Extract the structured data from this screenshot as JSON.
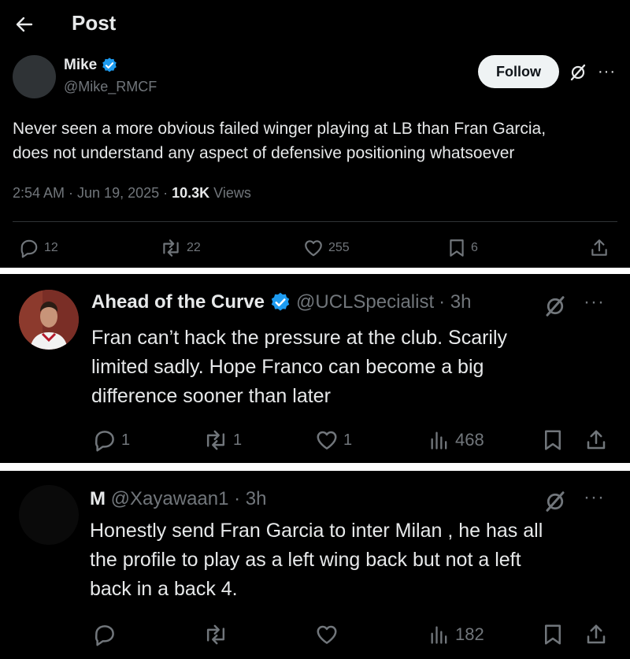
{
  "header": {
    "title": "Post",
    "back_icon": "arrow-left-icon"
  },
  "main_post": {
    "author_name": "Mike",
    "handle": "@Mike_RMCF",
    "follow_label": "Follow",
    "text_line1": "Never seen a more obvious failed winger playing at LB than Fran Garcia,",
    "text_line2": "does not understand any aspect of defensive positioning whatsoever",
    "timestamp": "2:54 AM · Jun 19, 2025 · ",
    "views_count": "10.3K",
    "views_label": " Views",
    "replies": "12",
    "reposts": "22",
    "likes": "255",
    "bookmarks": "6"
  },
  "reply1": {
    "author_name": "Ahead of the Curve",
    "handle": "@UCLSpecialist",
    "time": " · 3h",
    "text_line1": "Fran can’t hack the pressure at the club. Scarily",
    "text_line2": "limited sadly. Hope Franco can become a big",
    "text_line3": "difference sooner than later",
    "replies": "1",
    "reposts": "1",
    "likes": "1",
    "views": "468"
  },
  "reply2": {
    "author_name": "M",
    "handle": "@Xayawaan1",
    "time": " · 3h",
    "text_line1": "Honestly send Fran Garcia to inter Milan , he has all",
    "text_line2": "the profile to play as a left wing back but not a left",
    "text_line3": "back in a back 4.",
    "views": "182"
  },
  "colors": {
    "background": "#000000",
    "text": "#e7e9ea",
    "muted": "#71767b",
    "verified": "#1d9bf0",
    "separator": "#ffffff"
  }
}
